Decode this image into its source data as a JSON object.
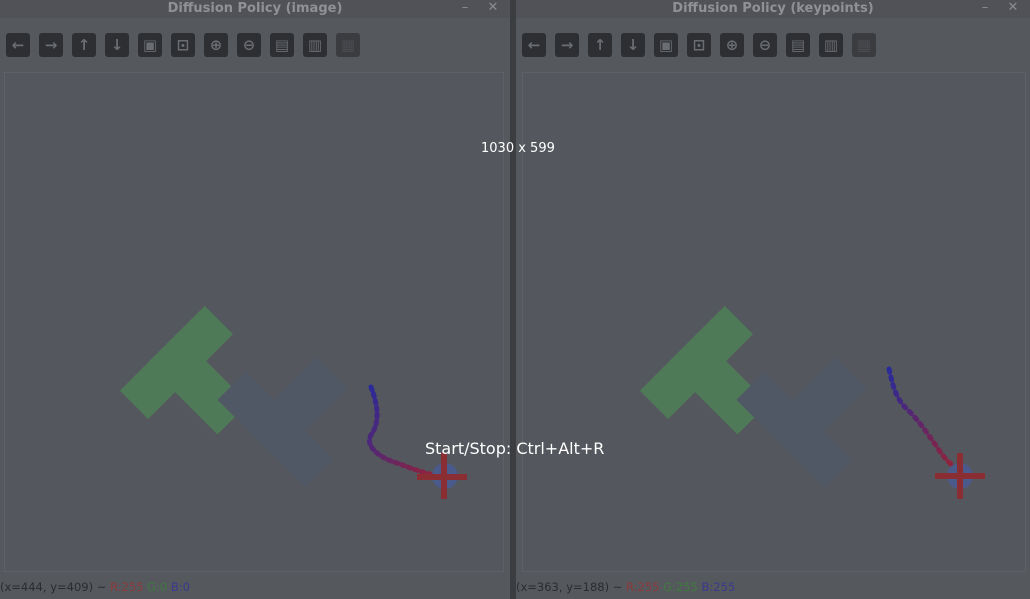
{
  "windows": {
    "left": {
      "title": "Diffusion Policy (image)",
      "minimize": "–",
      "close": "✕",
      "status": {
        "coords": "(x=444, y=409) ~",
        "r": "R:255",
        "g": "G:0",
        "b": "B:0"
      }
    },
    "right": {
      "title": "Diffusion Policy (keypoints)",
      "minimize": "–",
      "close": "✕",
      "status": {
        "coords": "(x=363, y=188) ~",
        "r": "R:255",
        "g": "G:255",
        "b": "B:255"
      }
    }
  },
  "toolbar_icons": [
    "arrow-left-icon",
    "arrow-right-icon",
    "arrow-up-icon",
    "arrow-down-icon",
    "zoom-to-fit-icon",
    "zoom-to-selection-icon",
    "zoom-in-icon",
    "zoom-out-icon",
    "save-icon",
    "copy-clipboard-icon",
    "properties-icon"
  ],
  "toolbar_glyphs": [
    "←",
    "→",
    "↑",
    "↓",
    "▣",
    "⊡",
    "⊕",
    "⊖",
    "▤",
    "▥",
    "▦"
  ],
  "overlay": {
    "size": "1030 x 599",
    "hint": "Start/Stop: Ctrl+Alt+R"
  },
  "colors": {
    "goal_t": "#4f7a58",
    "block_t": "#4f5864",
    "agent": "#8a2e33",
    "trajectory_start": "#2a2a9a",
    "trajectory_end": "#9a2233"
  }
}
